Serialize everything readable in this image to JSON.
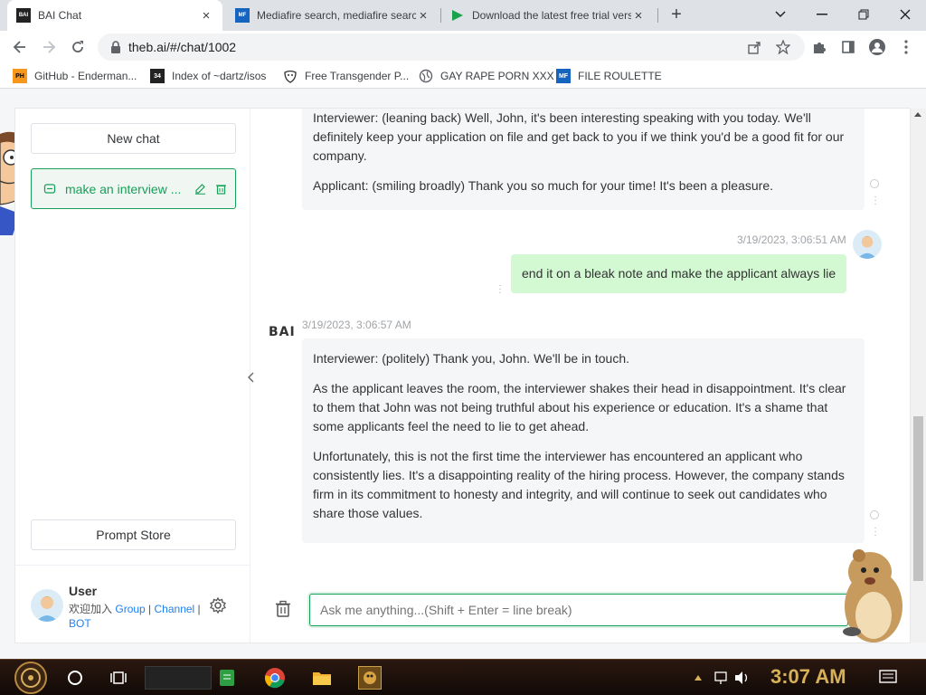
{
  "browser": {
    "tabs": [
      {
        "title": "BAI Chat",
        "favicon": "bai-favicon",
        "active": true
      },
      {
        "title": "Mediafire search, mediafire search engine",
        "favicon": "mediafire-favicon",
        "active": false
      },
      {
        "title": "Download the latest free trial version",
        "favicon": "play-favicon",
        "active": false
      }
    ],
    "url": "theb.ai/#/chat/1002",
    "bookmarks": [
      {
        "label": "GitHub - Enderman...",
        "icon": "PH"
      },
      {
        "label": "Index of ~dartz/isos",
        "icon": "34"
      },
      {
        "label": "Free Transgender P...",
        "icon": "mask"
      },
      {
        "label": "GAY RAPE PORN XXX",
        "icon": "globe"
      },
      {
        "label": "FILE ROULETTE",
        "icon": "MF"
      }
    ]
  },
  "sidebar": {
    "new_chat": "New chat",
    "chat_item": "make an interview ...",
    "prompt_store": "Prompt Store",
    "user": {
      "name": "User",
      "join_text": "欢迎加入",
      "link_group": "Group",
      "sep1": " | ",
      "link_channel": "Channel",
      "sep2": " |",
      "link_bot": "BOT"
    }
  },
  "chat": {
    "msg1": {
      "p1": "Interviewer: (leaning back) Well, John, it's been interesting speaking with you today. We'll definitely keep your application on file and get back to you if we think you'd be a good fit for our company.",
      "p2": "Applicant: (smiling broadly) Thank you so much for your time! It's been a pleasure."
    },
    "user_msg": {
      "timestamp": "3/19/2023, 3:06:51 AM",
      "text": "end it on a bleak note and make the applicant always lie"
    },
    "msg2": {
      "bot_label": "BAI",
      "timestamp": "3/19/2023, 3:06:57 AM",
      "p1": "Interviewer: (politely) Thank you, John. We'll be in touch.",
      "p2": "As the applicant leaves the room, the interviewer shakes their head in disappointment. It's clear to them that John was not being truthful about his experience or education. It's a shame that some applicants feel the need to lie to get ahead.",
      "p3": "Unfortunately, this is not the first time the interviewer has encountered an applicant who consistently lies. It's a disappointing reality of the hiring process. However, the company stands firm in its commitment to honesty and integrity, and will continue to seek out candidates who share those values."
    },
    "input_placeholder": "Ask me anything...(Shift + Enter = line break)"
  },
  "taskbar": {
    "clock": "3:07 AM"
  },
  "colors": {
    "accent": "#18a058",
    "user_bubble": "#d2f9d1",
    "bot_bubble": "#f4f6f8",
    "link": "#2080f0"
  }
}
